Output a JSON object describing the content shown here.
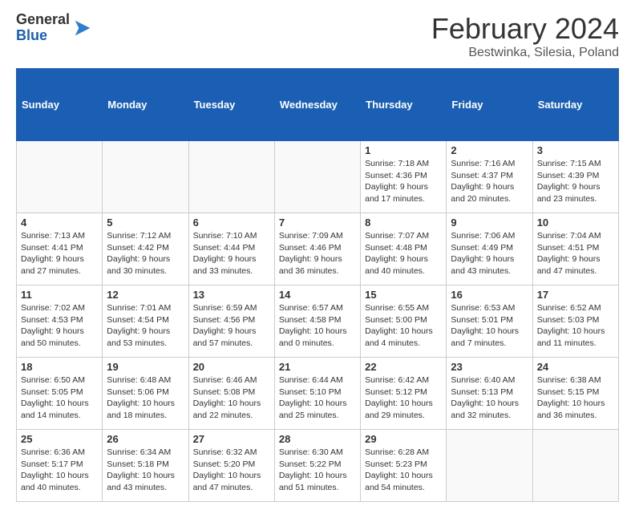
{
  "header": {
    "logo_line1": "General",
    "logo_line2": "Blue",
    "month_year": "February 2024",
    "location": "Bestwinka, Silesia, Poland"
  },
  "weekdays": [
    "Sunday",
    "Monday",
    "Tuesday",
    "Wednesday",
    "Thursday",
    "Friday",
    "Saturday"
  ],
  "weeks": [
    [
      {
        "day": "",
        "info": ""
      },
      {
        "day": "",
        "info": ""
      },
      {
        "day": "",
        "info": ""
      },
      {
        "day": "",
        "info": ""
      },
      {
        "day": "1",
        "info": "Sunrise: 7:18 AM\nSunset: 4:36 PM\nDaylight: 9 hours\nand 17 minutes."
      },
      {
        "day": "2",
        "info": "Sunrise: 7:16 AM\nSunset: 4:37 PM\nDaylight: 9 hours\nand 20 minutes."
      },
      {
        "day": "3",
        "info": "Sunrise: 7:15 AM\nSunset: 4:39 PM\nDaylight: 9 hours\nand 23 minutes."
      }
    ],
    [
      {
        "day": "4",
        "info": "Sunrise: 7:13 AM\nSunset: 4:41 PM\nDaylight: 9 hours\nand 27 minutes."
      },
      {
        "day": "5",
        "info": "Sunrise: 7:12 AM\nSunset: 4:42 PM\nDaylight: 9 hours\nand 30 minutes."
      },
      {
        "day": "6",
        "info": "Sunrise: 7:10 AM\nSunset: 4:44 PM\nDaylight: 9 hours\nand 33 minutes."
      },
      {
        "day": "7",
        "info": "Sunrise: 7:09 AM\nSunset: 4:46 PM\nDaylight: 9 hours\nand 36 minutes."
      },
      {
        "day": "8",
        "info": "Sunrise: 7:07 AM\nSunset: 4:48 PM\nDaylight: 9 hours\nand 40 minutes."
      },
      {
        "day": "9",
        "info": "Sunrise: 7:06 AM\nSunset: 4:49 PM\nDaylight: 9 hours\nand 43 minutes."
      },
      {
        "day": "10",
        "info": "Sunrise: 7:04 AM\nSunset: 4:51 PM\nDaylight: 9 hours\nand 47 minutes."
      }
    ],
    [
      {
        "day": "11",
        "info": "Sunrise: 7:02 AM\nSunset: 4:53 PM\nDaylight: 9 hours\nand 50 minutes."
      },
      {
        "day": "12",
        "info": "Sunrise: 7:01 AM\nSunset: 4:54 PM\nDaylight: 9 hours\nand 53 minutes."
      },
      {
        "day": "13",
        "info": "Sunrise: 6:59 AM\nSunset: 4:56 PM\nDaylight: 9 hours\nand 57 minutes."
      },
      {
        "day": "14",
        "info": "Sunrise: 6:57 AM\nSunset: 4:58 PM\nDaylight: 10 hours\nand 0 minutes."
      },
      {
        "day": "15",
        "info": "Sunrise: 6:55 AM\nSunset: 5:00 PM\nDaylight: 10 hours\nand 4 minutes."
      },
      {
        "day": "16",
        "info": "Sunrise: 6:53 AM\nSunset: 5:01 PM\nDaylight: 10 hours\nand 7 minutes."
      },
      {
        "day": "17",
        "info": "Sunrise: 6:52 AM\nSunset: 5:03 PM\nDaylight: 10 hours\nand 11 minutes."
      }
    ],
    [
      {
        "day": "18",
        "info": "Sunrise: 6:50 AM\nSunset: 5:05 PM\nDaylight: 10 hours\nand 14 minutes."
      },
      {
        "day": "19",
        "info": "Sunrise: 6:48 AM\nSunset: 5:06 PM\nDaylight: 10 hours\nand 18 minutes."
      },
      {
        "day": "20",
        "info": "Sunrise: 6:46 AM\nSunset: 5:08 PM\nDaylight: 10 hours\nand 22 minutes."
      },
      {
        "day": "21",
        "info": "Sunrise: 6:44 AM\nSunset: 5:10 PM\nDaylight: 10 hours\nand 25 minutes."
      },
      {
        "day": "22",
        "info": "Sunrise: 6:42 AM\nSunset: 5:12 PM\nDaylight: 10 hours\nand 29 minutes."
      },
      {
        "day": "23",
        "info": "Sunrise: 6:40 AM\nSunset: 5:13 PM\nDaylight: 10 hours\nand 32 minutes."
      },
      {
        "day": "24",
        "info": "Sunrise: 6:38 AM\nSunset: 5:15 PM\nDaylight: 10 hours\nand 36 minutes."
      }
    ],
    [
      {
        "day": "25",
        "info": "Sunrise: 6:36 AM\nSunset: 5:17 PM\nDaylight: 10 hours\nand 40 minutes."
      },
      {
        "day": "26",
        "info": "Sunrise: 6:34 AM\nSunset: 5:18 PM\nDaylight: 10 hours\nand 43 minutes."
      },
      {
        "day": "27",
        "info": "Sunrise: 6:32 AM\nSunset: 5:20 PM\nDaylight: 10 hours\nand 47 minutes."
      },
      {
        "day": "28",
        "info": "Sunrise: 6:30 AM\nSunset: 5:22 PM\nDaylight: 10 hours\nand 51 minutes."
      },
      {
        "day": "29",
        "info": "Sunrise: 6:28 AM\nSunset: 5:23 PM\nDaylight: 10 hours\nand 54 minutes."
      },
      {
        "day": "",
        "info": ""
      },
      {
        "day": "",
        "info": ""
      }
    ]
  ]
}
